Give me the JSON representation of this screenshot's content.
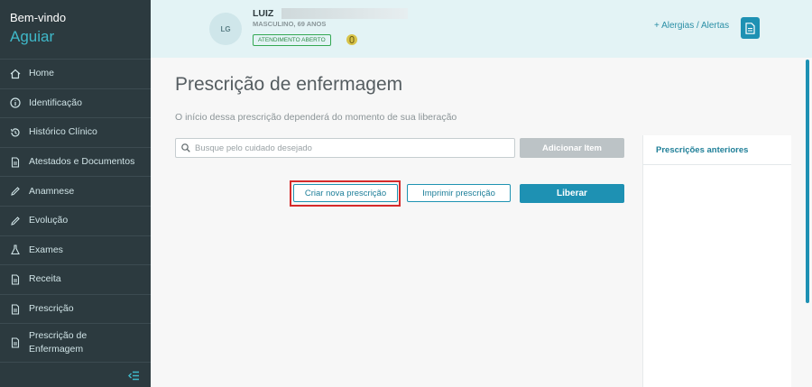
{
  "sidebar": {
    "welcome": "Bem-vindo",
    "user": "Aguiar",
    "items": [
      {
        "label": "Home",
        "icon": "home-icon"
      },
      {
        "label": "Identificação",
        "icon": "info-icon"
      },
      {
        "label": "Histórico Clínico",
        "icon": "history-icon"
      },
      {
        "label": "Atestados e Documentos",
        "icon": "document-icon"
      },
      {
        "label": "Anamnese",
        "icon": "pencil-icon"
      },
      {
        "label": "Evolução",
        "icon": "pencil-icon"
      },
      {
        "label": "Exames",
        "icon": "flask-icon"
      },
      {
        "label": "Receita",
        "icon": "document-icon"
      },
      {
        "label": "Prescrição",
        "icon": "document-icon"
      },
      {
        "label": "Prescrição de Enfermagem",
        "icon": "document-icon"
      }
    ]
  },
  "header": {
    "avatar_initials": "LG",
    "patient_name": "LUIZ",
    "patient_info": "MASCULINO, 69 ANOS",
    "status_badge": "ATENDIMENTO ABERTO",
    "alerts_link": "+ Alergias / Alertas"
  },
  "main": {
    "title": "Prescrição de enfermagem",
    "subtitle": "O início dessa prescrição dependerá do momento de sua liberação",
    "search_placeholder": "Busque pelo cuidado desejado",
    "add_item_label": "Adicionar Item",
    "create_label": "Criar nova prescrição",
    "print_label": "Imprimir prescrição",
    "release_label": "Liberar"
  },
  "previous_panel": {
    "title": "Prescrições anteriores"
  },
  "colors": {
    "sidebar_bg": "#2c3a3f",
    "accent": "#1e91b3",
    "highlight": "#d62b2b"
  }
}
